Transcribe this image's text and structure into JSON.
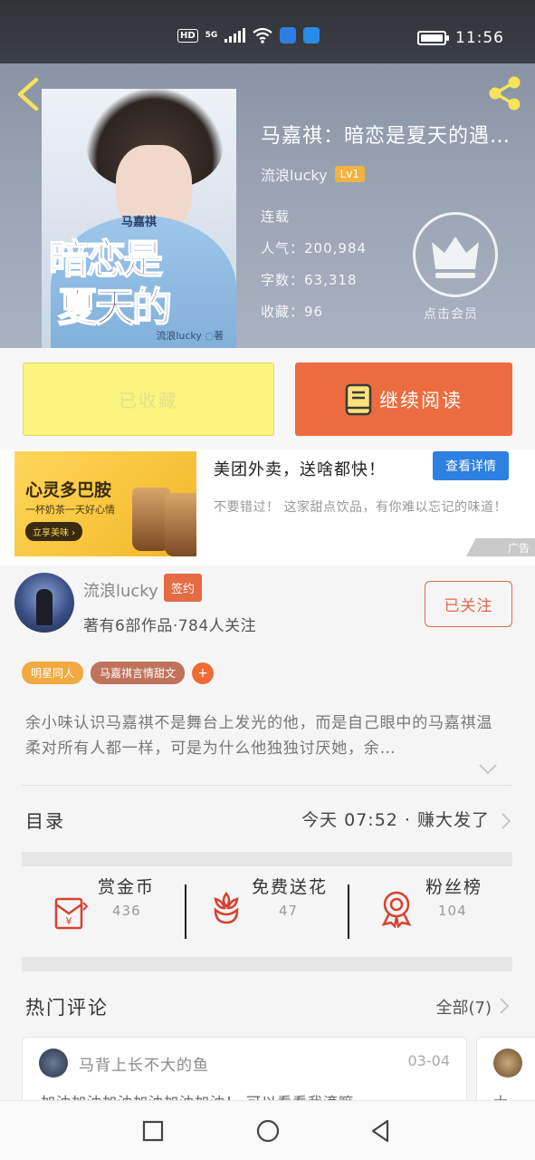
{
  "status_bar": {
    "hd": "HD",
    "network": "5G",
    "time": "11:56",
    "colors": {
      "badge_blue": "#2f7de1",
      "badge_cloud": "#2a8be8"
    }
  },
  "book": {
    "title": "马嘉祺：暗恋是夏天的遇…",
    "author": "流浪lucky",
    "level": "Lv1",
    "status": "连载",
    "popularity": "人气：200,984",
    "word_count": "字数：63,318",
    "favorites": "收藏：96",
    "vip_label": "点击会员",
    "cover": {
      "author_text": "马嘉祺",
      "title_line1": "暗恋是",
      "title_line2": "夏天的",
      "byline": "流浪lucky ◌著"
    }
  },
  "actions": {
    "collected_label": "已收藏",
    "read_label": "继续阅读",
    "colors": {
      "collect_bg": "#fbf47f",
      "read_bg": "#ec6b3f"
    }
  },
  "ad": {
    "image_headline": "心灵多巴胺",
    "image_sub": "一杯奶茶一天好心情",
    "image_button": "立享美味 ›",
    "title": "美团外卖，送啥都快！",
    "detail_button": "查看详情",
    "description": "不要错过！ 这家甜点饮品，有你难以忘记的味道！",
    "tag": "广告"
  },
  "author_section": {
    "name": "流浪lucky",
    "sign_badge": "签约",
    "summary": "著有6部作品·784人关注",
    "follow_button": "已关注",
    "tags": [
      {
        "label": "明星同人",
        "color": "#f2a93f"
      },
      {
        "label": "马嘉祺言情甜文",
        "color": "#c0735c"
      }
    ],
    "add_tag": "+",
    "synopsis": "余小味认识马嘉祺不是舞台上发光的他，而是自己眼中的马嘉祺温柔对所有人都一样，可是为什么他独独讨厌她，余…"
  },
  "toc": {
    "label": "目录",
    "latest": "今天 07:52 · 赚大发了"
  },
  "stats": [
    {
      "label": "赏金币",
      "value": "436",
      "icon": "red-envelope-icon"
    },
    {
      "label": "免费送花",
      "value": "47",
      "icon": "flower-icon"
    },
    {
      "label": "粉丝榜",
      "value": "104",
      "icon": "medal-icon"
    }
  ],
  "comments": {
    "title": "热门评论",
    "all_label": "全部(7)",
    "items": [
      {
        "user": "马背上长不大的鱼",
        "date": "03-04",
        "text": "加油加油加油加油加油加油！ 可以看看我滴嘛~一"
      },
      {
        "user": "",
        "date": "",
        "text": "大"
      }
    ]
  },
  "navbar": {
    "icons": [
      "square-icon",
      "circle-icon",
      "triangle-back-icon"
    ]
  }
}
